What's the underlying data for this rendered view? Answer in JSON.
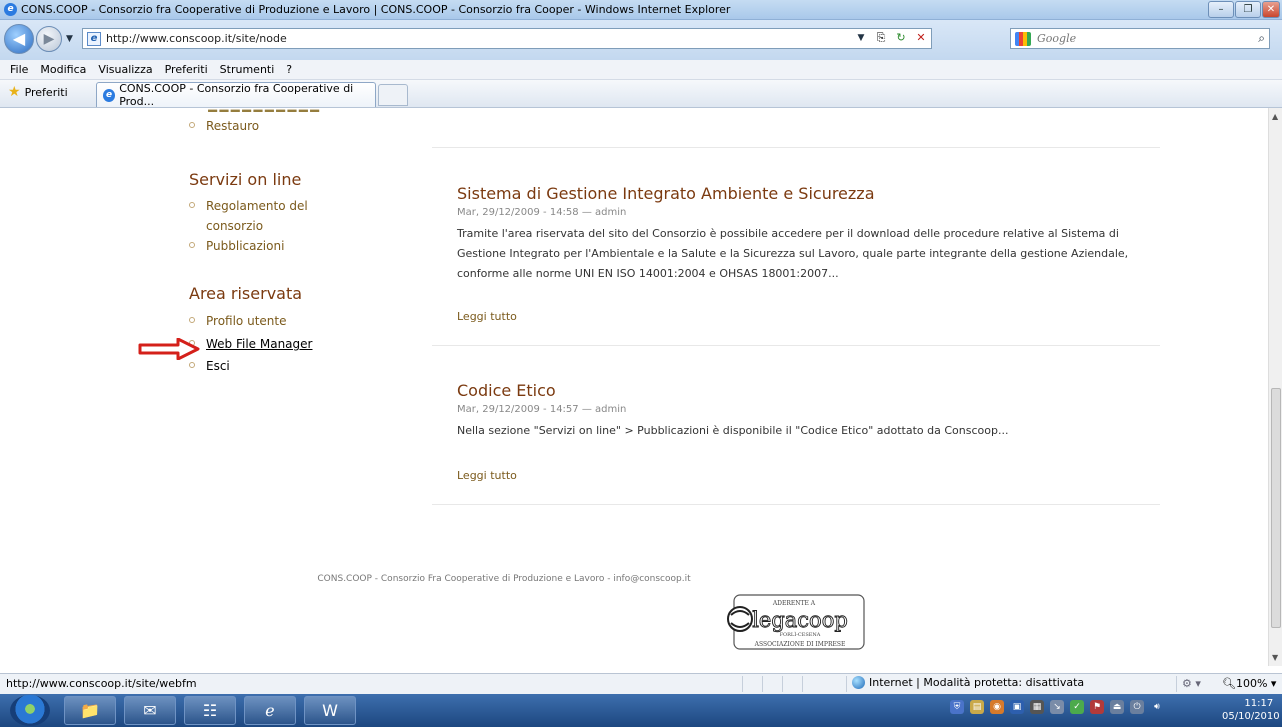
{
  "window": {
    "title": "CONS.COOP - Consorzio fra Cooperative di Produzione e Lavoro | CONS.COOP - Consorzio fra Cooper - Windows Internet Explorer"
  },
  "address": {
    "url": "http://www.conscoop.it/site/node",
    "search_placeholder": "Google"
  },
  "menu": [
    "File",
    "Modifica",
    "Visualizza",
    "Preferiti",
    "Strumenti",
    "?"
  ],
  "favorites": {
    "label": "Preferiti",
    "tab_title": "CONS.COOP - Consorzio fra Cooperative di Prod..."
  },
  "sidebar": {
    "top_item": "Restauro",
    "sections": [
      {
        "title": "Servizi on line",
        "items": [
          "Regolamento del consorzio",
          "Pubblicazioni"
        ]
      },
      {
        "title": "Area riservata",
        "items": [
          "Profilo utente",
          "Web File Manager",
          "Esci"
        ]
      }
    ]
  },
  "articles": [
    {
      "title": "Sistema di Gestione Integrato Ambiente e Sicurezza",
      "meta": "Mar, 29/12/2009 - 14:58 — admin",
      "body": "Tramite l'area riservata del sito del Consorzio è possibile accedere per il download delle procedure relative al Sistema di Gestione Integrato per l'Ambientale e la Salute e la Sicurezza sul Lavoro, quale parte integrante della gestione Aziendale, conforme alle norme UNI EN ISO 14001:2004 e OHSAS 18001:2007...",
      "more": "Leggi tutto"
    },
    {
      "title": "Codice Etico",
      "meta": "Mar, 29/12/2009 - 14:57 — admin",
      "body": "Nella sezione \"Servizi on line\" > Pubblicazioni è disponibile il \"Codice Etico\" adottato da Conscoop...",
      "more": "Leggi tutto"
    }
  ],
  "footer": {
    "text": "CONS.COOP - Consorzio Fra Cooperative di Produzione e Lavoro - info@conscoop.it",
    "logo_top": "ADERENTE A",
    "logo_main": "legacoop",
    "logo_sub": "FORLÌ-CESENA",
    "logo_bottom": "ASSOCIAZIONE DI IMPRESE"
  },
  "status": {
    "url": "http://www.conscoop.it/site/webfm",
    "zone": "Internet | Modalità protetta: disattivata",
    "zoom": "100%"
  },
  "taskbar": {
    "time": "11:17",
    "date": "05/10/2010"
  },
  "colors": {
    "heading": "#7b3a10",
    "link": "#7b5a1c",
    "arrow": "#d4201a"
  }
}
